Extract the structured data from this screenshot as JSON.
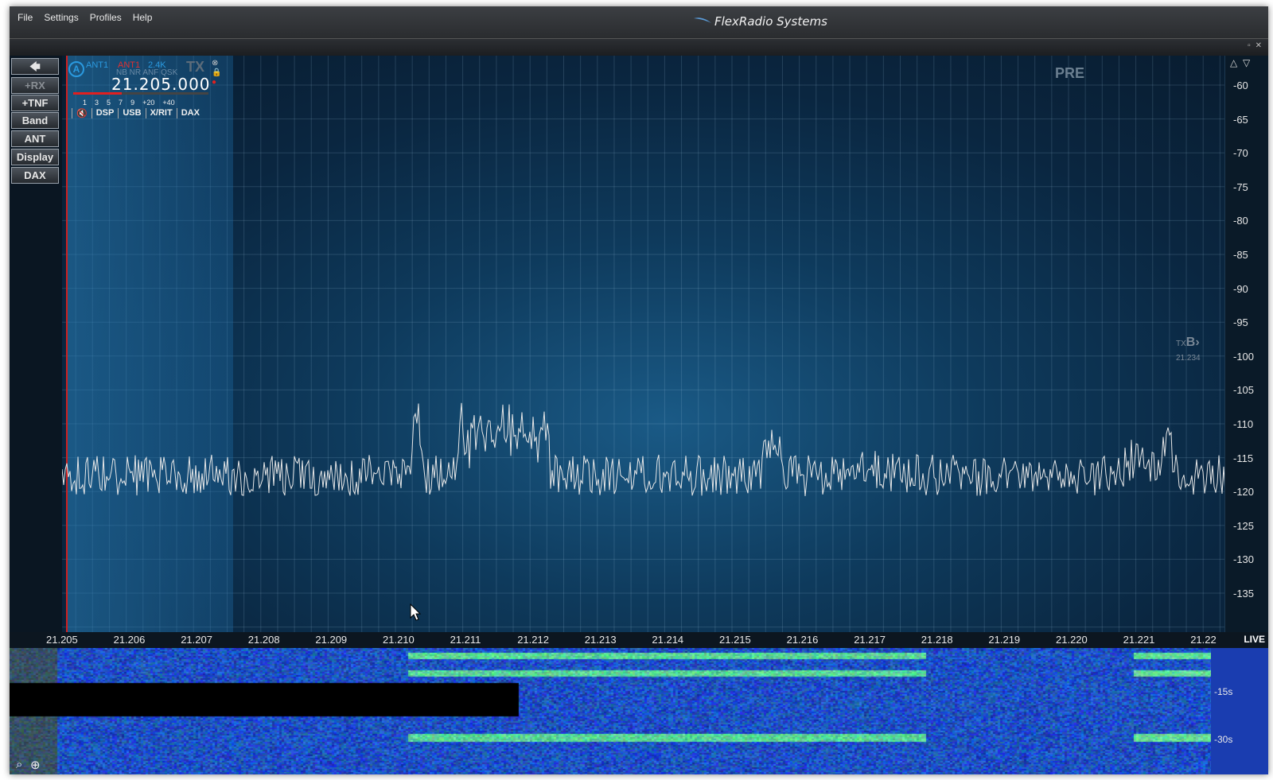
{
  "menu": {
    "items": [
      "File",
      "Settings",
      "Profiles",
      "Help"
    ]
  },
  "app_title": "FlexRadio Systems",
  "pan_controls": {
    "restore": "▫",
    "close": "✕"
  },
  "sidebar": {
    "arrow": "🡄",
    "buttons": [
      "+RX",
      "+TNF",
      "Band",
      "ANT",
      "Display",
      "DAX"
    ]
  },
  "slice": {
    "letter": "A",
    "rx_ant": "ANT1",
    "tx_ant": "ANT1",
    "bandwidth": "2.4K",
    "tx_label": "TX",
    "dsp_flags": "NB NR ANF QSK",
    "frequency": "21.205.000",
    "s_scale": [
      "1",
      "3",
      "5",
      "7",
      "9",
      "+20",
      "+40"
    ],
    "buttons": [
      "DSP",
      "USB",
      "X/RIT",
      "DAX"
    ],
    "mute_icon": "speaker-mute-icon"
  },
  "pre_label": "PRE",
  "txb": {
    "label": "TX",
    "letter": "B",
    "freq": "21.234"
  },
  "dbm_scale": [
    "-60",
    "-65",
    "-70",
    "-75",
    "-80",
    "-85",
    "-90",
    "-95",
    "-100",
    "-105",
    "-110",
    "-115",
    "-120",
    "-125",
    "-130",
    "-135"
  ],
  "freq_axis": [
    "21.205",
    "21.206",
    "21.207",
    "21.208",
    "21.209",
    "21.210",
    "21.211",
    "21.212",
    "21.213",
    "21.214",
    "21.215",
    "21.216",
    "21.217",
    "21.218",
    "21.219",
    "21.220",
    "21.221",
    "21.22"
  ],
  "live_label": "LIVE",
  "waterfall_times": [
    "-15s",
    "-30s"
  ],
  "colors": {
    "accent": "#2a9ae0",
    "slice_marker": "#d02020",
    "trace": "#e8e8e8"
  }
}
